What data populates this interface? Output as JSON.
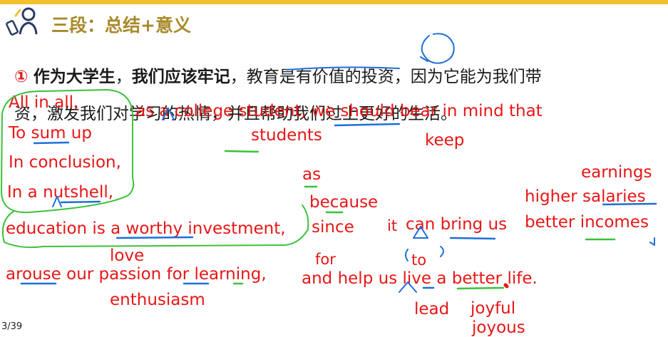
{
  "header": {
    "title": "三段：总结+意义"
  },
  "paragraph": {
    "number": "①",
    "line1_bold_a": "作为大学生",
    "line1_sep_a": "，",
    "line1_bold_b": "我们应该牢记",
    "line1_rest": "，教育是有价值的投资，因为它能为我们带",
    "line2": "资，激发我们对学习的热情，并且帮助我们过上更好的生活。"
  },
  "annotations": {
    "all_in_all": "All in all,",
    "as_college": "as a college student, we should bear in mind that",
    "to_sum_up": "To sum up",
    "in_conclusion": "In conclusion,",
    "in_a_nutshell": "In a nutshell,",
    "students": "students",
    "keep": "keep",
    "as": "as",
    "because": "because",
    "since": "since",
    "earnings": "earnings",
    "higher_salaries": "higher salaries",
    "better_incomes": "better incomes",
    "education_line": "education is a worthy investment,",
    "it": "it",
    "can_bring_us": "can bring us",
    "love": "love",
    "for": "for",
    "to": "to",
    "arouse_line": "arouse our passion for  learning,",
    "help_line": "and help us live a better life.",
    "enthusiasm": "enthusiasm",
    "lead": "lead",
    "joyful": "joyful",
    "joyous": "joyous"
  },
  "footer": {
    "page": "3/39"
  },
  "colors": {
    "accent": "#f3c12e",
    "title": "#a8892a",
    "annotation": "#e81616",
    "ink_blue": "#1e6fd6",
    "ink_green": "#3ac23a"
  }
}
